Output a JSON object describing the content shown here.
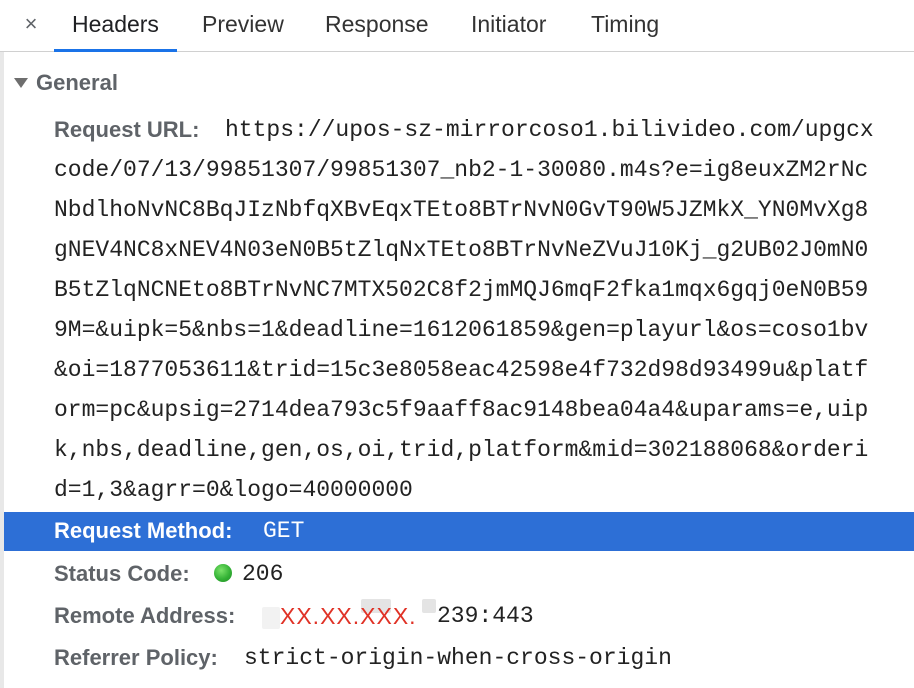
{
  "tabs": [
    {
      "label": "Headers",
      "active": true
    },
    {
      "label": "Preview",
      "active": false
    },
    {
      "label": "Response",
      "active": false
    },
    {
      "label": "Initiator",
      "active": false
    },
    {
      "label": "Timing",
      "active": false
    }
  ],
  "close_icon": "×",
  "general": {
    "title": "General",
    "request_url": {
      "label": "Request URL:",
      "lines": [
        "https://upos-sz-mirrorcoso1.bilivideo.com/upgcx",
        "code/07/13/99851307/99851307_nb2-1-30080.m4s?e=ig8euxZM2rNc",
        "NbdlhoNvNC8BqJIzNbfqXBvEqxTEto8BTrNvN0GvT90W5JZMkX_YN0MvXg8",
        "gNEV4NC8xNEV4N03eN0B5tZlqNxTEto8BTrNvNeZVuJ10Kj_g2UB02J0mN0",
        "B5tZlqNCNEto8BTrNvNC7MTX502C8f2jmMQJ6mqF2fka1mqx6gqj0eN0B59",
        "9M=&uipk=5&nbs=1&deadline=1612061859&gen=playurl&os=coso1bv",
        "&oi=1877053611&trid=15c3e8058eac42598e4f732d98d93499u&platf",
        "orm=pc&upsig=2714dea793c5f9aaff8ac9148bea04a4&uparams=e,uip",
        "k,nbs,deadline,gen,os,oi,trid,platform&mid=302188068&orderi",
        "d=1,3&agrr=0&logo=40000000"
      ]
    },
    "request_method": {
      "label": "Request Method:",
      "value": "GET"
    },
    "status_code": {
      "label": "Status Code:",
      "value": "206",
      "status_color": "#34b236"
    },
    "remote_address": {
      "label": "Remote Address:",
      "redacted_text": "XX.XX.XXX.",
      "value": "239:443"
    },
    "referrer_policy": {
      "label": "Referrer Policy:",
      "value": "strict-origin-when-cross-origin"
    }
  },
  "colors": {
    "selection": "#2d6fd6",
    "active_tab_underline": "#1a73e8",
    "redaction": "#e03226"
  }
}
